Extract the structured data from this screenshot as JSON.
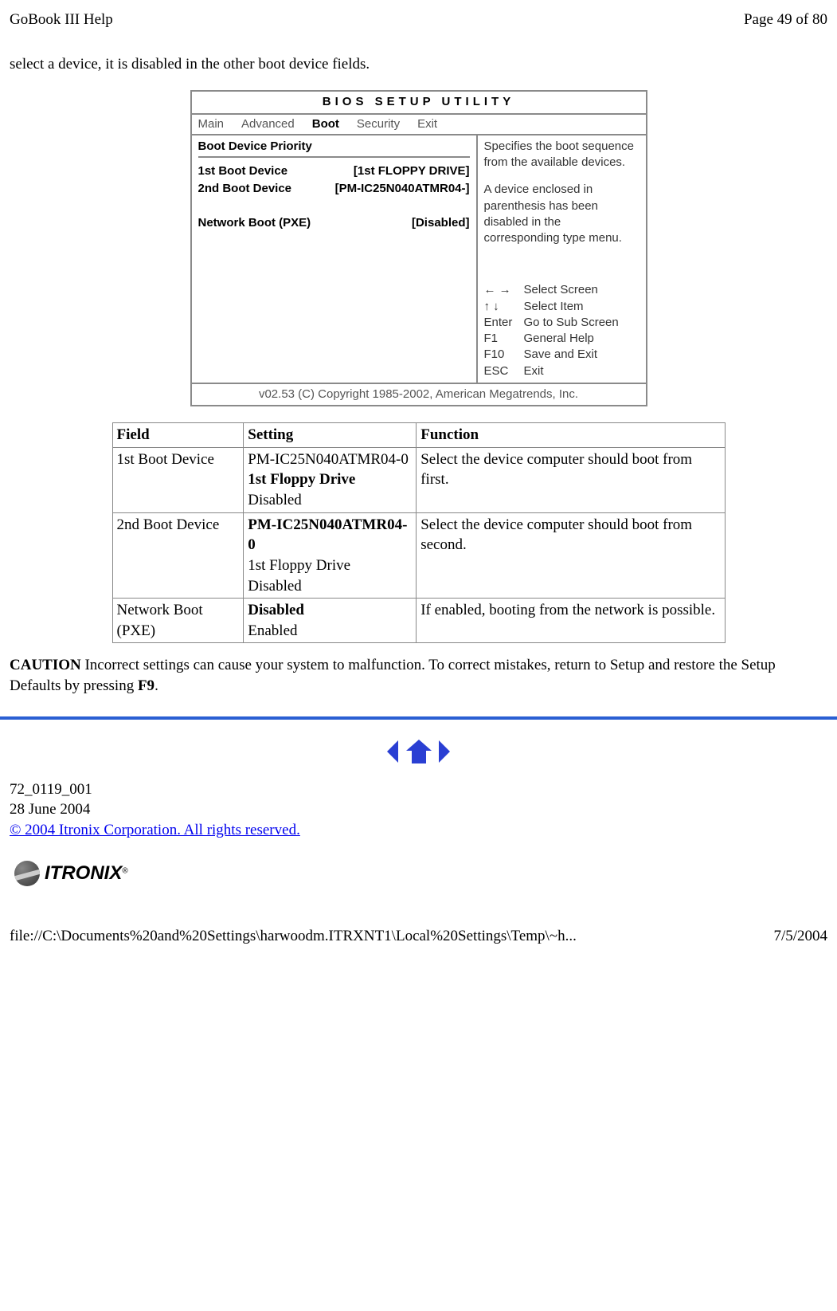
{
  "header": {
    "title": "GoBook III Help",
    "page_info": "Page 49 of 80"
  },
  "intro_text": "select a device, it is disabled in the other boot device fields.",
  "bios": {
    "title": "BIOS   SETUP   UTILITY",
    "tabs": [
      "Main",
      "Advanced",
      "Boot",
      "Security",
      "Exit"
    ],
    "section_title": "Boot Device Priority",
    "rows": [
      {
        "label": "1st Boot Device",
        "value": "[1st FLOPPY DRIVE]"
      },
      {
        "label": "2nd Boot Device",
        "value": "[PM-IC25N040ATMR04-]"
      }
    ],
    "network_row": {
      "label": "Network Boot (PXE)",
      "value": "[Disabled]"
    },
    "help1": "Specifies the boot sequence from the available devices.",
    "help2": "A device enclosed in parenthesis has been disabled in the corresponding type menu.",
    "keys": [
      {
        "k": "← →",
        "v": "Select Screen"
      },
      {
        "k": "↑ ↓",
        "v": "Select Item"
      },
      {
        "k": "Enter",
        "v": "Go to Sub Screen"
      },
      {
        "k": "F1",
        "v": "General Help"
      },
      {
        "k": "F10",
        "v": "Save and Exit"
      },
      {
        "k": "ESC",
        "v": "Exit"
      }
    ],
    "footer": "v02.53 (C) Copyright 1985-2002, American Megatrends, Inc."
  },
  "table": {
    "headers": [
      "Field",
      "Setting",
      "Function"
    ],
    "rows": [
      {
        "field": "1st Boot Device",
        "setting_plain1": "PM-IC25N040ATMR04-0",
        "setting_bold": "1st Floppy Drive",
        "setting_plain2": "Disabled",
        "function": "Select the device computer should boot from first."
      },
      {
        "field": "2nd Boot Device",
        "setting_bold": "PM-IC25N040ATMR04-0",
        "setting_plain1": "1st Floppy Drive",
        "setting_plain2": "Disabled",
        "function": "Select the device computer should boot from second."
      },
      {
        "field": "Network Boot (PXE)",
        "setting_bold": "Disabled",
        "setting_plain1": "Enabled",
        "function": "If enabled, booting from the network is possible."
      }
    ]
  },
  "caution": {
    "label": "CAUTION",
    "text_before": "  Incorrect settings can cause your system to malfunction. To correct mistakes, return to Setup and restore the Setup Defaults by pressing ",
    "key": "F9",
    "text_after": "."
  },
  "footer_info": {
    "doc_num": "72_0119_001",
    "date": "28 June 2004",
    "copyright": "© 2004 Itronix Corporation.  All rights reserved."
  },
  "logo": {
    "text": "ITRONIX",
    "reg": "®"
  },
  "page_footer": {
    "path": "file://C:\\Documents%20and%20Settings\\harwoodm.ITRXNT1\\Local%20Settings\\Temp\\~h...",
    "date": "7/5/2004"
  }
}
